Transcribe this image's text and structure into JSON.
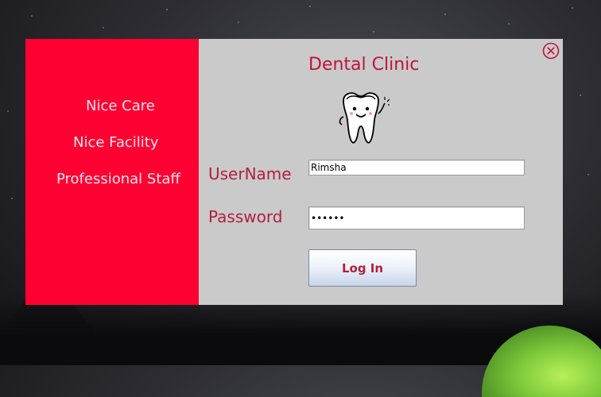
{
  "left_panel": {
    "features": [
      "Nice Care",
      "Nice Facility",
      "Professional Staff"
    ],
    "color": "#ff0033"
  },
  "right_panel": {
    "title": "Dental Clinic",
    "mascot_icon": "tooth-mascot-icon",
    "close_icon": "close-circle-icon"
  },
  "form": {
    "username_label": "UserName",
    "username_value": "Rimsha",
    "password_label": "Password",
    "password_value": "rimsha",
    "login_label": "Log In"
  },
  "colors": {
    "accent": "#ff0033",
    "label_text": "#b21e3c",
    "panel_bg": "#cacaca"
  }
}
